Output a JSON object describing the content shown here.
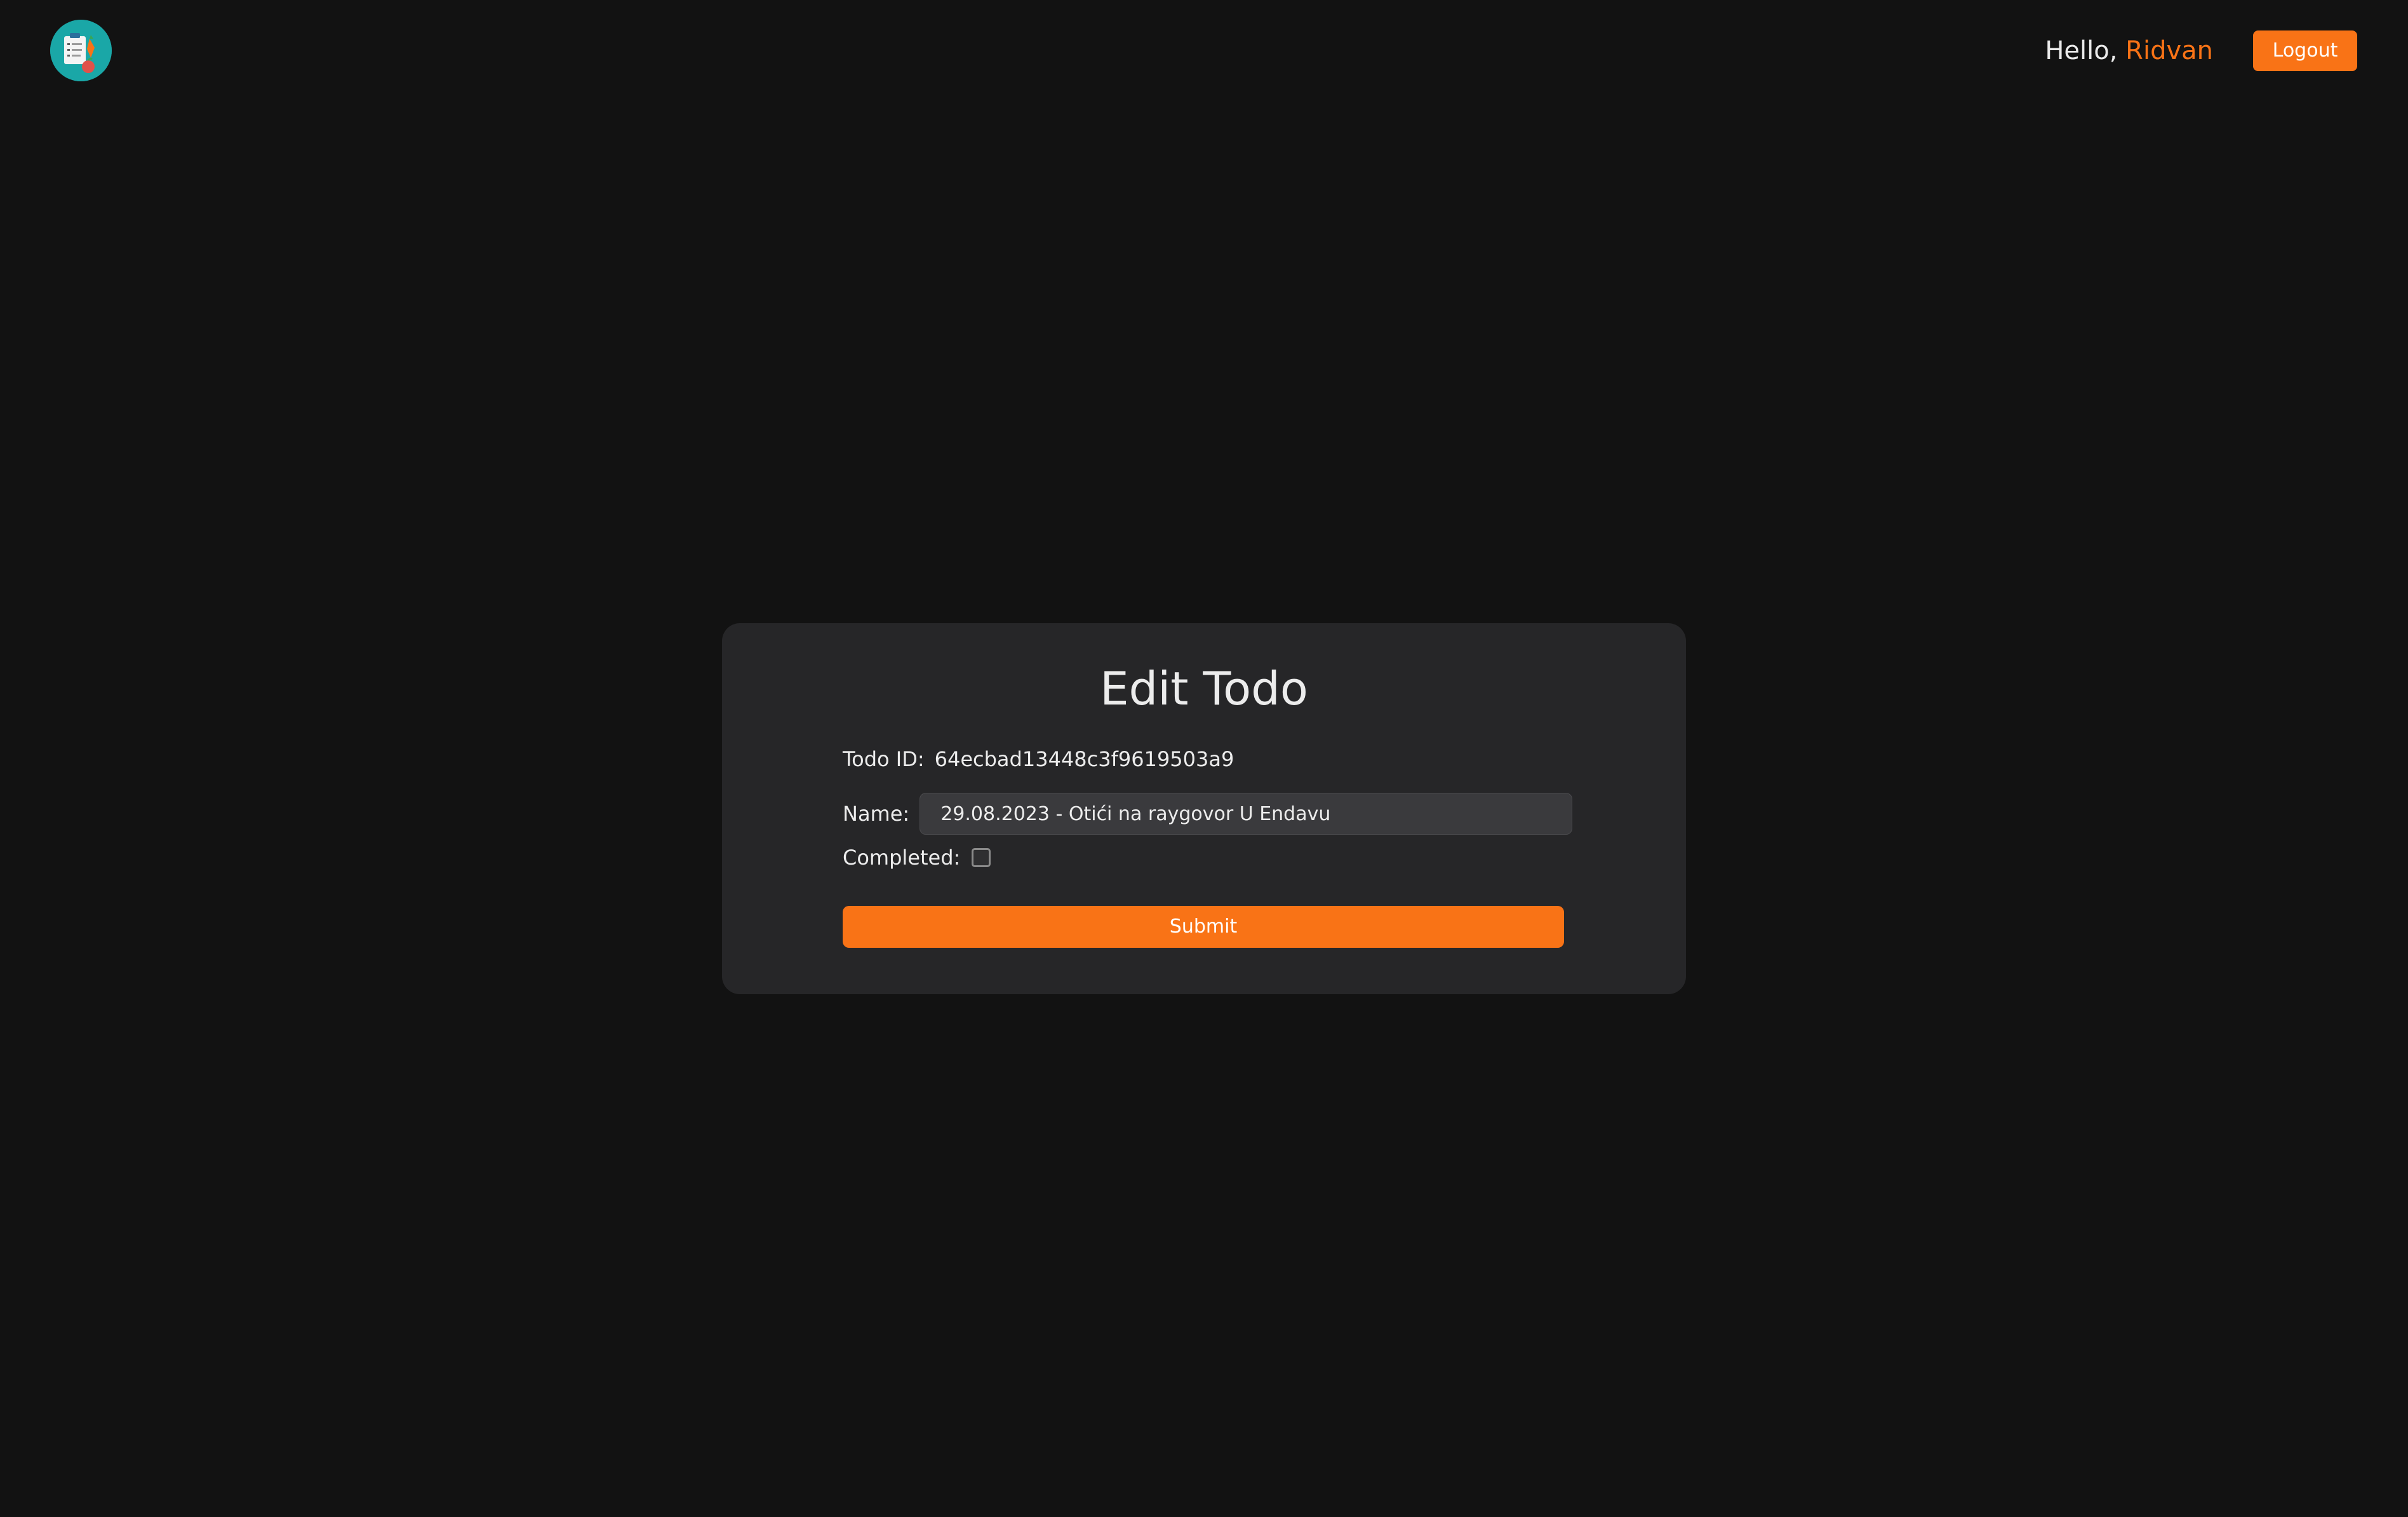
{
  "header": {
    "logo_icon": "clipboard-checklist-logo-icon",
    "greeting_prefix": "Hello, ",
    "username": "Ridvan",
    "logout_label": "Logout"
  },
  "form": {
    "title": "Edit Todo",
    "todo_id_label": "Todo ID:",
    "todo_id_value": "64ecbad13448c3f9619503a9",
    "name_label": "Name:",
    "name_value": "29.08.2023 - Otići na raygovor U Endavu",
    "completed_label": "Completed:",
    "completed": false,
    "submit_label": "Submit"
  },
  "colors": {
    "accent": "#f97316",
    "background": "#121212",
    "card": "#262628",
    "input": "#3a3a3d",
    "logo_circle": "#1aa7a7"
  }
}
